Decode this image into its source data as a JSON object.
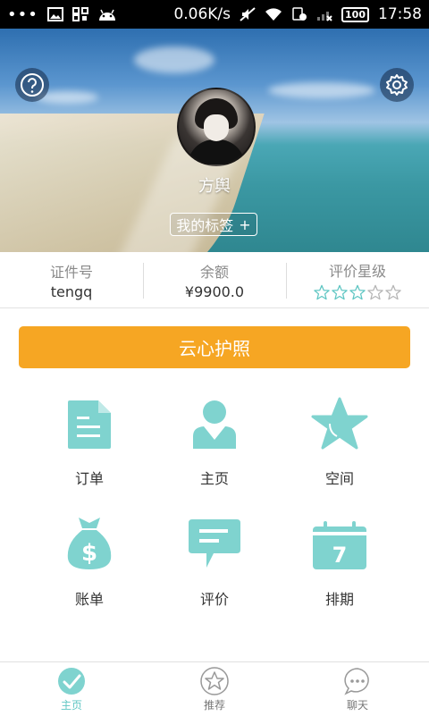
{
  "status_bar": {
    "speed": "0.06K/s",
    "battery": "100",
    "time": "17:58"
  },
  "profile": {
    "name": "方舆",
    "tag_button": "我的标签",
    "tag_plus": "+"
  },
  "info": [
    {
      "label": "证件号",
      "value": "tengq"
    },
    {
      "label": "余额",
      "value": "¥9900.0"
    },
    {
      "label": "评价星级",
      "rating": 3,
      "max": 5
    }
  ],
  "passport_button": "云心护照",
  "grid": [
    {
      "label": "订单",
      "icon": "document-icon"
    },
    {
      "label": "主页",
      "icon": "user-icon"
    },
    {
      "label": "空间",
      "icon": "star-icon"
    },
    {
      "label": "账单",
      "icon": "money-bag-icon"
    },
    {
      "label": "评价",
      "icon": "chat-bubble-icon"
    },
    {
      "label": "排期",
      "icon": "calendar-icon",
      "day": "7"
    }
  ],
  "bottom_nav": [
    {
      "label": "主页",
      "active": true
    },
    {
      "label": "推荐",
      "active": false
    },
    {
      "label": "聊天",
      "active": false
    }
  ],
  "colors": {
    "accent": "#5fc6c3",
    "passport": "#f6a623",
    "icon": "#7fd3cf"
  }
}
